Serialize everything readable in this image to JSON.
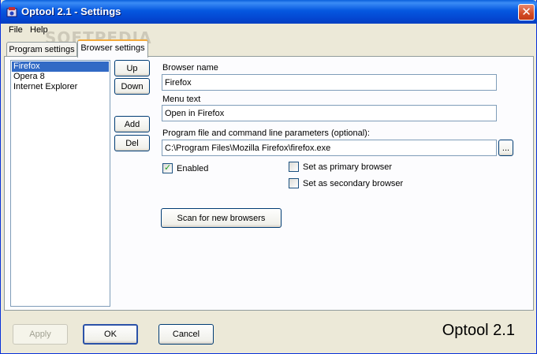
{
  "window": {
    "title": "Optool 2.1 - Settings",
    "close_glyph": "✕"
  },
  "menu": {
    "file": "File",
    "help": "Help"
  },
  "watermark": "SOFTPEDIA",
  "tabs": [
    {
      "label": "Program settings",
      "active": false
    },
    {
      "label": "Browser settings",
      "active": true
    }
  ],
  "browser_list": {
    "items": [
      "Firefox",
      "Opera 8",
      "Internet Explorer"
    ],
    "selected": "Firefox"
  },
  "list_buttons": {
    "up": "Up",
    "down": "Down",
    "add": "Add",
    "del": "Del"
  },
  "form": {
    "browser_name_label": "Browser name",
    "browser_name_value": "Firefox",
    "menu_text_label": "Menu text",
    "menu_text_value": "Open in Firefox",
    "program_label": "Program file and command line parameters (optional):",
    "program_value": "C:\\Program Files\\Mozilla Firefox\\firefox.exe",
    "browse_label": "...",
    "enabled_label": "Enabled",
    "enabled_checked": true,
    "primary_label": "Set as primary browser",
    "primary_checked": false,
    "secondary_label": "Set as secondary browser",
    "secondary_checked": false,
    "scan_label": "Scan for new browsers"
  },
  "footer": {
    "apply": "Apply",
    "apply_enabled": false,
    "ok": "OK",
    "cancel": "Cancel",
    "brand": "Optool 2.1"
  },
  "icons": {
    "app": "optool-app-icon",
    "close": "close-icon",
    "check": "checkmark-icon"
  }
}
